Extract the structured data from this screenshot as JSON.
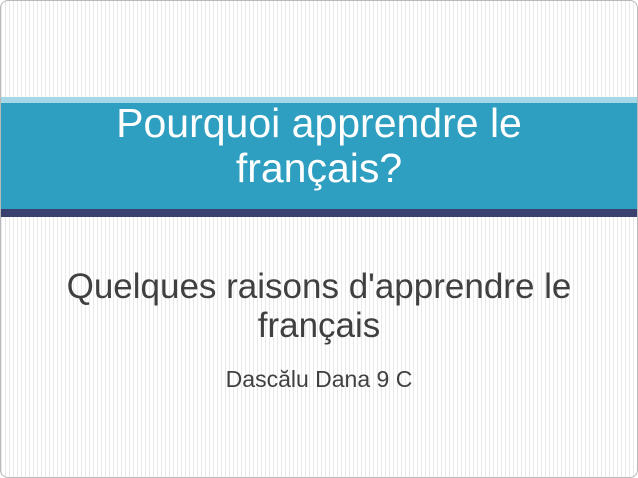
{
  "slide": {
    "title_lines": [
      "Pourquoi apprendre le",
      "français?"
    ],
    "subtitle_lines": [
      "Quelques raisons d'apprendre le",
      "français"
    ],
    "author": "Dascălu Dana 9 C"
  },
  "colors": {
    "title_band": "#2e9fc0",
    "band_top": "#a5d7e6",
    "band_bottom": "#3a416e",
    "title_text": "#ffffff",
    "body_text": "#404040"
  }
}
